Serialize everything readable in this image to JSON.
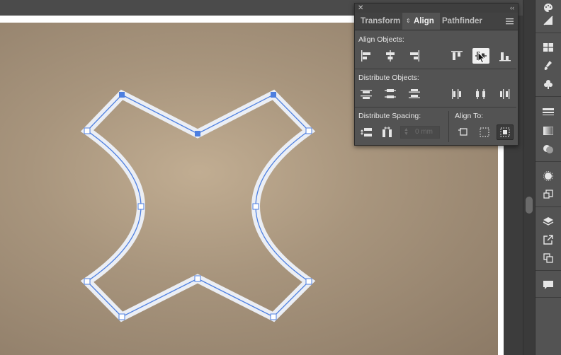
{
  "panel": {
    "tabs": [
      {
        "label": "Transform"
      },
      {
        "label": "Align"
      },
      {
        "label": "Pathfinder"
      }
    ],
    "align_objects_label": "Align Objects:",
    "distribute_objects_label": "Distribute Objects:",
    "distribute_spacing_label": "Distribute Spacing:",
    "align_to_label": "Align To:",
    "spacing_value": "0 mm"
  },
  "colors": {
    "path_stroke": "#4d7fe0",
    "anchor_selected": "#4d7fe0",
    "shape_outline": "#ebeef4",
    "panel_bg": "#535353",
    "canvas_texture": "#a8957d"
  },
  "toolbar_icons": [
    "palette-icon",
    "gradient-swatch-icon",
    "swatches-icon",
    "brushes-icon",
    "symbols-icon",
    "stroke-icon",
    "gradient-icon",
    "transparency-icon",
    "appearance-icon",
    "graphic-styles-icon",
    "layers-icon",
    "export-icon",
    "artboards-icon",
    "comments-icon"
  ]
}
